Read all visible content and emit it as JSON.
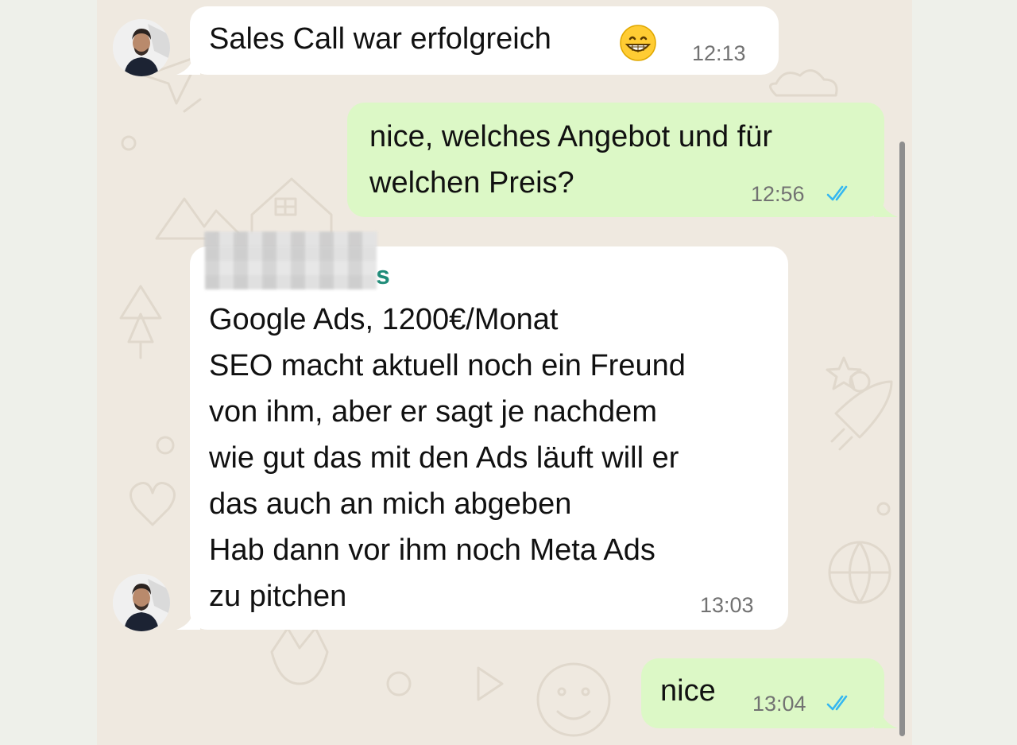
{
  "messages": [
    {
      "id": "m1",
      "direction": "incoming",
      "text": "Sales Call war erfolgreich",
      "emoji": "grinning-face",
      "time": "12:13"
    },
    {
      "id": "m2",
      "direction": "outgoing",
      "text": "nice, welches Angebot und für\nwelchen Preis?",
      "time": "12:56",
      "status": "read"
    },
    {
      "id": "m3",
      "direction": "incoming",
      "sender_visible_fragment": "s",
      "text": "Google Ads, 1200€/Monat\nSEO macht aktuell noch ein Freund\nvon ihm, aber er sagt je nachdem\nwie gut das mit den Ads läuft will er\ndas auch an mich abgeben\nHab dann vor ihm noch Meta Ads\nzu pitchen",
      "time": "13:03"
    },
    {
      "id": "m4",
      "direction": "outgoing",
      "text": "nice",
      "time": "13:04",
      "status": "read"
    }
  ],
  "colors": {
    "incoming_bubble": "#ffffff",
    "outgoing_bubble": "#dcf8c6",
    "chat_background": "#efe9e0",
    "sender_name": "#1f8c79",
    "read_ticks": "#34b7f1",
    "timestamp": "#727272"
  }
}
